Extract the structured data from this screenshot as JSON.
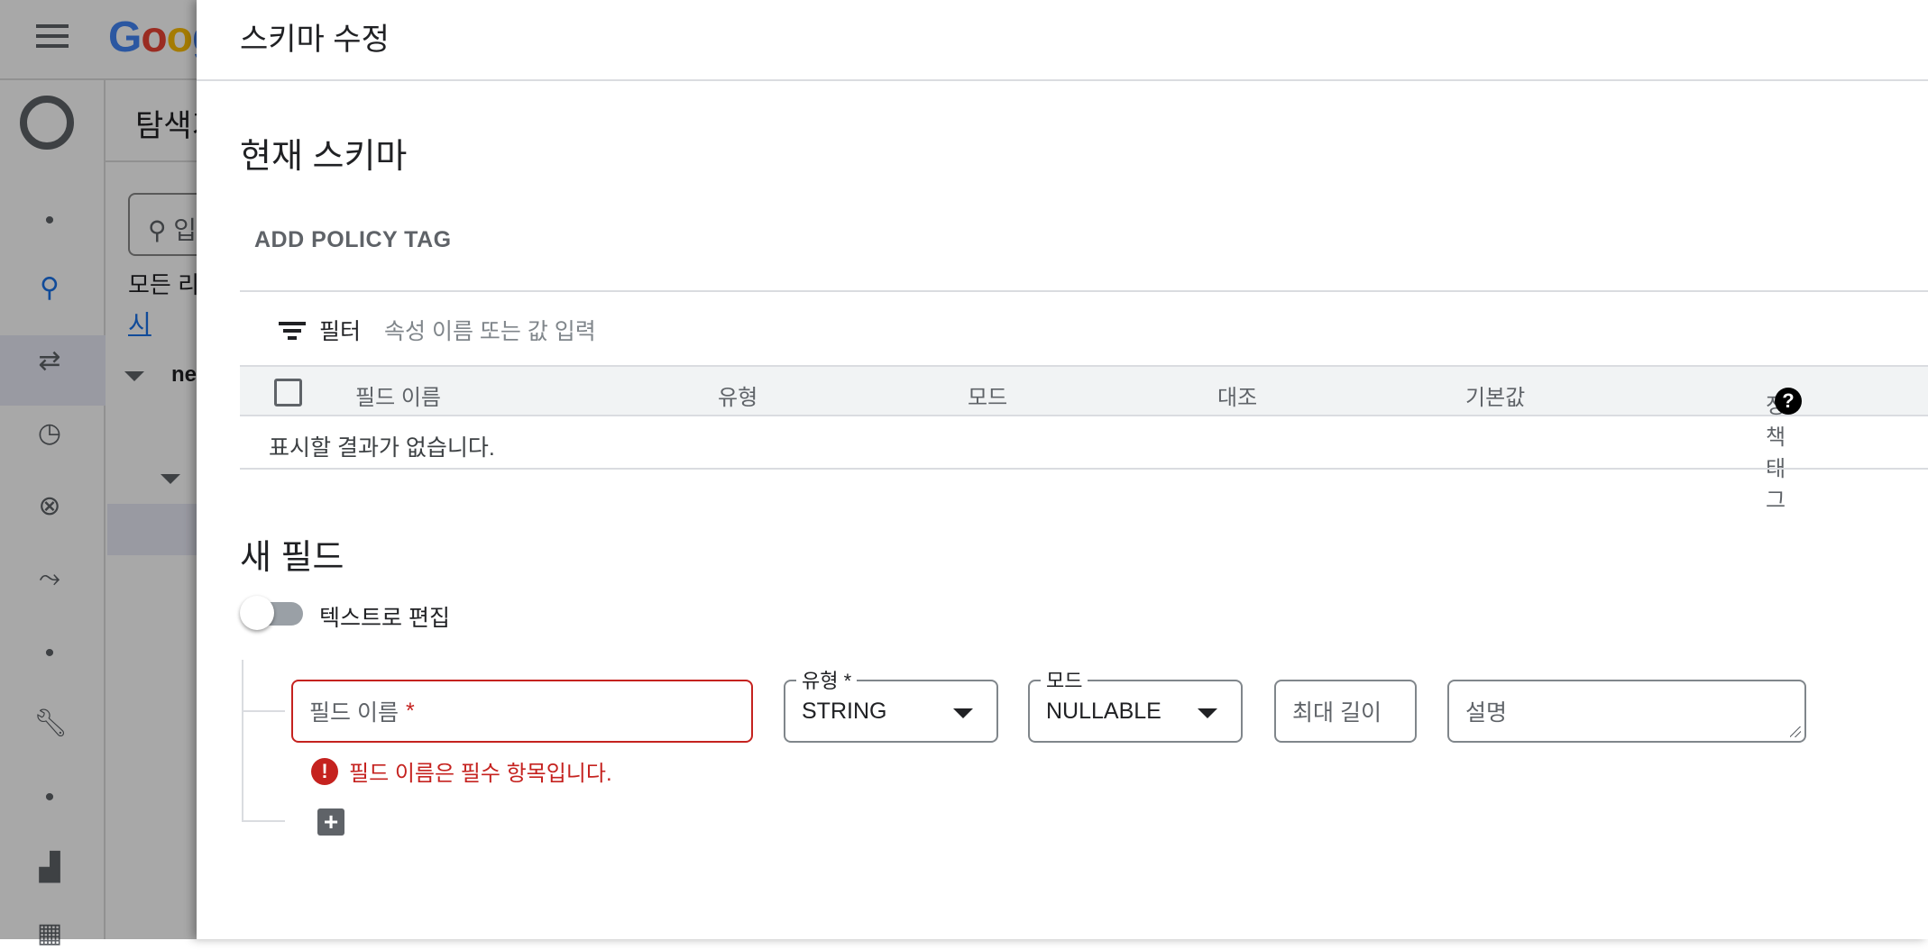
{
  "background": {
    "logo": "Google",
    "explorer_title": "탐색기",
    "search_placeholder": "입",
    "all_resources": "모든 리",
    "link": "시",
    "node": "ne"
  },
  "panel": {
    "title": "스키마 수정",
    "current_schema": {
      "heading": "현재 스키마",
      "add_policy_tag": "ADD POLICY TAG",
      "filter_label": "필터",
      "filter_placeholder": "속성 이름 또는 값 입력",
      "columns": [
        "필드 이름",
        "유형",
        "모드",
        "대조",
        "기본값",
        "정책 태그"
      ],
      "empty_message": "표시할 결과가 없습니다."
    },
    "new_field": {
      "heading": "새 필드",
      "edit_as_text": "텍스트로 편집",
      "edit_as_text_on": false,
      "field_name_placeholder": "필드 이름",
      "required_mark": "*",
      "type_label": "유형 *",
      "type_value": "STRING",
      "mode_label": "모드",
      "mode_value": "NULLABLE",
      "max_length_placeholder": "최대 길이",
      "description_placeholder": "설명",
      "error": "필드 이름은 필수 항목입니다."
    }
  },
  "colors": {
    "error": "#c5221f",
    "accent": "#1a73e8"
  }
}
